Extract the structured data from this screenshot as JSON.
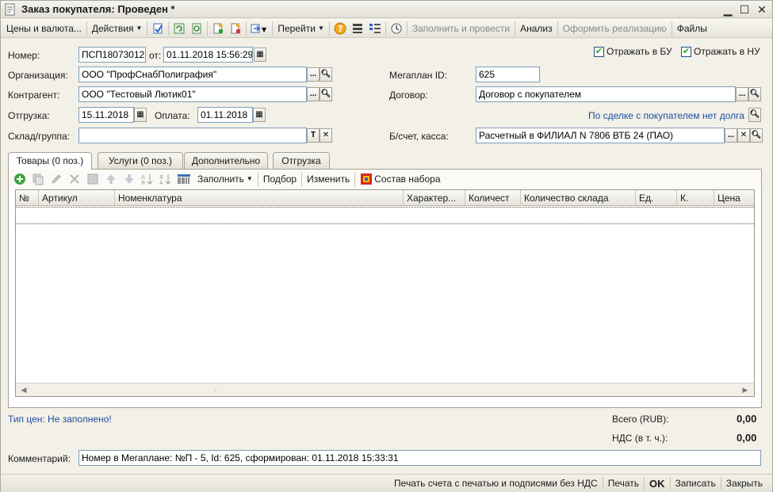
{
  "window": {
    "title": "Заказ покупателя: Проведен *"
  },
  "toolbar": {
    "prices": "Цены и валюта...",
    "actions": "Действия",
    "goto": "Перейти",
    "fill_post": "Заполнить и провести",
    "analysis": "Анализ",
    "make_sale": "Оформить реализацию",
    "files": "Файлы"
  },
  "form": {
    "number_label": "Номер:",
    "number_value": "ПСП18073012",
    "from_label": "от:",
    "date_value": "01.11.2018 15:56:29",
    "reflect_bu": "Отражать в БУ",
    "reflect_nu": "Отражать в НУ",
    "org_label": "Организация:",
    "org_value": "ООО \"ПрофСнабПолиграфия\"",
    "megaplan_label": "Мегаплан ID:",
    "megaplan_value": "625",
    "contractor_label": "Контрагент:",
    "contractor_value": "ООО \"Тестовый Лютик01\"",
    "contract_label": "Договор:",
    "contract_value": "Договор с покупателем",
    "shipment_label": "Отгрузка:",
    "shipment_value": "15.11.2018",
    "payment_label": "Оплата:",
    "payment_value": "01.11.2018",
    "debt_link": "По сделке с покупателем нет долга",
    "warehouse_label": "Склад/группа:",
    "warehouse_value": "",
    "account_label": "Б/счет, касса:",
    "account_value": "Расчетный в ФИЛИАЛ N 7806 ВТБ 24 (ПАО)"
  },
  "tabs": [
    {
      "label": "Товары (0 поз.)"
    },
    {
      "label": "Услуги (0 поз.)"
    },
    {
      "label": "Дополнительно"
    },
    {
      "label": "Отгрузка"
    }
  ],
  "subtoolbar": {
    "fill": "Заполнить",
    "selection": "Подбор",
    "change": "Изменить",
    "kit": "Состав набора"
  },
  "grid": {
    "columns": [
      "№",
      "Артикул",
      "Номенклатура",
      "Характер...",
      "Количест",
      "Количество склада",
      "Ед.",
      "К.",
      "Цена"
    ]
  },
  "footer": {
    "price_type": "Тип цен: Не заполнено!",
    "total_label": "Всего (RUB):",
    "total_value": "0,00",
    "vat_label": "НДС (в т. ч.):",
    "vat_value": "0,00",
    "comment_label": "Комментарий:",
    "comment_value": "Номер в Мегаплане: №П - 5, Id: 625, сформирован: 01.11.2018 15:33:31"
  },
  "buttons": {
    "print_invoice": "Печать счета с печатью и подписями без НДС",
    "print": "Печать",
    "ok": "OK",
    "save": "Записать",
    "close": "Закрыть"
  }
}
